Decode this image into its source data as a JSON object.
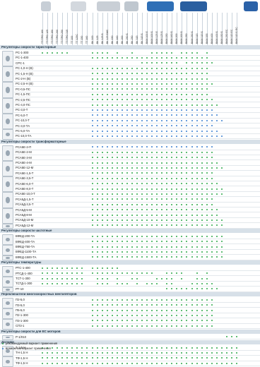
{
  "colors": {
    "recommended": "#2ea84a",
    "possible": "#3b7fd0",
    "section_bg": "#d7e0e8",
    "section_text": "#1e3446"
  },
  "columns": [
    "ТТ ПРО 100",
    "ТТ ПРО 125",
    "ТТ ПРО 150",
    "ТТ ПРО 200",
    "ТТ ПРО 250",
    "ТТ ПРО 315",
    "ТТ 100",
    "ТТ 125С",
    "ТТ 150",
    "ТТ 160",
    "ВК 100",
    "ВК 125",
    "ВК 125 Б",
    "ВК 125 БМС",
    "ВК 150",
    "ВК 160",
    "ВК 200",
    "ВК 250 Б",
    "ВК 250",
    "ВК 315",
    "ВК 315 Б",
    "ВКМ 100 Е",
    "ВКМ 100 Б",
    "ВКМ 125 Е",
    "ВКМ 125 Б",
    "ВКМ 150",
    "ВКМ 160 Б",
    "ВКМ 200",
    "ВКМ 200 Б",
    "ВКМ 250",
    "ВКМ 250 Б",
    "ВКМ 315",
    "ВКМ 315 Б",
    "ВКМ 355",
    "ВКМ 400",
    "ВКМ 400 Б",
    "ВКМ 450 Б",
    "ВКМ 250 ЕС",
    "ВКМ 315 ЕС",
    "ВКМ 315 Б ЕС"
  ],
  "sections": [
    {
      "title": "Регуляторы скорости тиристорные",
      "rows": [
        {
          "label": "РС-1-300",
          "marks": "GGGGGG....GGGG.G..G...GGGGG.GGGG.G......"
        },
        {
          "label": "РС-1-400",
          "marks": "..........GGGGGGGGGGGGGGGGGGGGGGGG......"
        },
        {
          "label": "CPC-1",
          "marks": "....................GGGGGGGG.GGGGGG....."
        },
        {
          "label": "РС-1,0-Н (В)",
          "marks": "..........GGGGGGGGGGGGGGGGGGGGGGGG......"
        },
        {
          "label": "РС-1,5-Н (В)",
          "marks": "..........GGGGGGGGGGGGGGGGGGGGGGGG......"
        },
        {
          "label": "РС-2-Н (В)",
          "marks": "..........GGGGGGGGGGGGGGGGGGGGGGGG......"
        },
        {
          "label": "РС-2,5-Н (В)",
          "marks": "..........GGGGGGGGGGGGGGGGGGGGGGGGG....."
        },
        {
          "label": "РС-0,5-ПС",
          "marks": "..........GGGGGGGGGGGGGGGGGGGGGGGG......"
        },
        {
          "label": "РС-1,5-ПС",
          "marks": "..........GGGGGGGGGGGGGGGGGGGGGGGG......"
        },
        {
          "label": "РС-2,5-ПС",
          "marks": "..........GGGGGGGGGGGGGGGGGGGGGGGGG....."
        },
        {
          "label": "РС-4,0-ПС",
          "marks": "..........GGGGGGGGGGGGGGGGGGGGGGGGGG...."
        },
        {
          "label": "РС-3,0-Т",
          "marks": "..........BBBBBBBBBBBBBBBBBBBBBBBBB....."
        },
        {
          "label": "РС-5,0-Т",
          "marks": "..........BBBBBBBBBBBBBBBBBBBBBBBBBB...."
        },
        {
          "label": "РС-10,0-Т",
          "marks": "..........BBBBBBBBBBBBBBBBBBBBBBBBBBB..."
        },
        {
          "label": "РС-3,0-ТА",
          "marks": "..........BBBBBBBBBBBBBBBBBBBBBBBBB....."
        },
        {
          "label": "РС-5,0-ТА",
          "marks": "..........BBBBBBBBBBBBBBBBBBBBBBBBBB...."
        },
        {
          "label": "РС-10,0-ТА",
          "marks": "..........BBBBBBBBBBBBBBBBBBBBBBBBBBB..."
        }
      ]
    },
    {
      "title": "Регуляторы скорости трансформаторные",
      "rows": [
        {
          "label": "РСА5Е-2-П",
          "marks": "..........BBBBBBBBBBBBBBBBBBBBBBBBB....."
        },
        {
          "label": "РСА5Е-2-М",
          "marks": "..........GGGGGGGGGGGGGGGGGGGGGGGGG....."
        },
        {
          "label": "РСА5Е-3-М",
          "marks": "..........GGGGGGGGGGGGGGGGGGGGGGGGG....."
        },
        {
          "label": "РСА5Е-4-М",
          "marks": "..........GGGGGGGGGGGGGGGGGGGGGGGGGG...."
        },
        {
          "label": "РСА5Е-12-М",
          "marks": "..........GGGGGGGGGGGGGGGGGGGGGGGGGGG..."
        },
        {
          "label": "РСА5Е-1,5-Т",
          "marks": "..........GGGGGGGGGGGGGGGGGGGGGGGGG....."
        },
        {
          "label": "РСА5Е-3,5-Т",
          "marks": "..........GGGGGGGGGGGGGGGGGGGGGGGGG....."
        },
        {
          "label": "РСА5Е-6,0-Т",
          "marks": "..........GGGGGGGGGGGGGGGGGGGGGGGGGG...."
        },
        {
          "label": "РСА5Е-8,0-Т",
          "marks": "..........GGGGGGGGGGGGGGGGGGGGGGGGGGG..."
        },
        {
          "label": "РСА5Е-10,0-Т",
          "marks": "..........GGGGGGGGGGGGGGGGGGGGGGGGGGG..."
        },
        {
          "label": "РСА5Д-1,5-Т",
          "marks": "..........GGGGGGGGGGGGGGGGGGGGGGGGG....."
        },
        {
          "label": "РСА5Д-3,5-Т",
          "marks": "..........GGGGGGGGGGGGGGGGGGGGGGGGG....."
        },
        {
          "label": "РСА5Д-5-М",
          "marks": "..........GGGGGGGGGGGGGGGGGGGGGGGGGG...."
        },
        {
          "label": "РСА5Д-8-М",
          "marks": "..........GGGGGGGGGGGGGGGGGGGGGGGGGG...."
        },
        {
          "label": "РСА5Д-10-М",
          "marks": "..........GGGGGGGGGGGGGGGGGGGGGGGGGGG..."
        },
        {
          "label": "РСА5Д-12-М",
          "marks": "..........GGGGGGGGGGGGGGGGGGGGGGGGGGG..."
        }
      ]
    },
    {
      "title": "Регуляторы скорости частотные",
      "rows": [
        {
          "label": "ВФЕД-200-ТА",
          "marks": "..........GGGGGGGGGGGGGGGGGGGGGGGGGGG..."
        },
        {
          "label": "ВФЕД-400-ТА",
          "marks": "..........GGGGGGGGGGGGGGGGGGGGGGGGGGG..."
        },
        {
          "label": "ВФЕД-750-ТА",
          "marks": "..........GGGGGGGGGGGGGGGGGGGGGGGGGGG..."
        },
        {
          "label": "ВФЕД-1100-ТА",
          "marks": "..........GGGGGGGGGGGGGGGGGGGGGGGGGGG..."
        },
        {
          "label": "ВФЕД-1500-ТА",
          "marks": "..........GGGGGGGGGGGGGGGGGGGGGGGGGGG..."
        }
      ]
    },
    {
      "title": "Регуляторы температуры",
      "rows": [
        {
          "label": "РТС-1-400",
          "marks": "GGGGGGGGG.GGGGGG......................."
        },
        {
          "label": "РТСД-1-400",
          "marks": "GGGGGGGGG.GGGGGGGGGGGGG..GGGG..G.G......"
        },
        {
          "label": "ТСТ-1-300",
          "marks": "GGGGGGGGG..GGG.G..GG...GGGG.G..GGG......"
        },
        {
          "label": "ТСТД-1-300",
          "marks": "GGGGGGGGG..GGG.GGG.G.GGG.GG...GGGGG....."
        },
        {
          "label": "РТ-10",
          "marks": ".........................GGGGGGGGGGG...."
        }
      ]
    },
    {
      "title": "Переключатели многоскоростных вентиляторов",
      "rows": [
        {
          "label": "П2-5,0",
          "marks": "..........GGGGGGGGGGGGGGGGGGGGGGGGG....."
        },
        {
          "label": "П3-5,0",
          "marks": "..........GGGGGGGGGGGGGGGGGGGGGGGGG....."
        },
        {
          "label": "П5-5,0",
          "marks": "..........GGGGGGGGGGGGGGGGGGGGGGGGG....."
        },
        {
          "label": "П2-1-300",
          "marks": "..........GGGGGGGGGGGGGGGGGGGGGGGGG....."
        },
        {
          "label": "П3-1-300",
          "marks": "..........GGGGGGGGGGGGGGGGGGGGGGGGG....."
        },
        {
          "label": "СП3-1",
          "marks": "..........GGGGGGGGGGGGGGGGGGGGGGGGG....."
        }
      ]
    },
    {
      "title": "Регуляторы скорости для ЕС моторов",
      "rows": [
        {
          "label": "Р-1/010",
          "marks": ".....................................GGG"
        }
      ]
    },
    {
      "title": "Датчики",
      "rows": [
        {
          "label": "Т-1,5 Н",
          "marks": "GGGGGGGGGGGGGGGGGGGGGGGGGGGGGGGGGGGGGGGG"
        },
        {
          "label": "ТН-1,5 Н",
          "marks": "GGGGGGGGGGGGGGGGGGGGGGGGGGGGGGGGGGGGGGGG"
        },
        {
          "label": "ТФ-1,5 Н",
          "marks": "GGGGGGGGGGGGGGGGGGGGGGGGGGGGGGGGGGGGGGGG"
        },
        {
          "label": "ТФ-1,5 Н",
          "marks": "GGGGGGGGGGGGGGGGGGGGGGGGGGGGGGGGGGGGGGGG"
        }
      ]
    }
  ],
  "legend": [
    {
      "color": "recommended",
      "text": "рекомендуемый вариант применения"
    },
    {
      "color": "possible",
      "text": "возможный вариант применения"
    }
  ],
  "header_icons": [
    {
      "name": "duct-fan-tt-pro-icon",
      "color": "#c7ced6"
    },
    {
      "name": "duct-fan-tt-icon",
      "color": "#d3d8de"
    },
    {
      "name": "duct-fan-vk-icon",
      "color": "#c9cfd6"
    },
    {
      "name": "duct-fan-vk-b-icon",
      "color": "#bfc7cf"
    },
    {
      "name": "duct-fan-vkm-icon",
      "color": "#2f6fb6"
    },
    {
      "name": "duct-fan-vkm-b-icon",
      "color": "#2a5fa0"
    },
    {
      "name": "duct-fan-vkm-ec-icon",
      "color": "#2b62a8"
    }
  ]
}
